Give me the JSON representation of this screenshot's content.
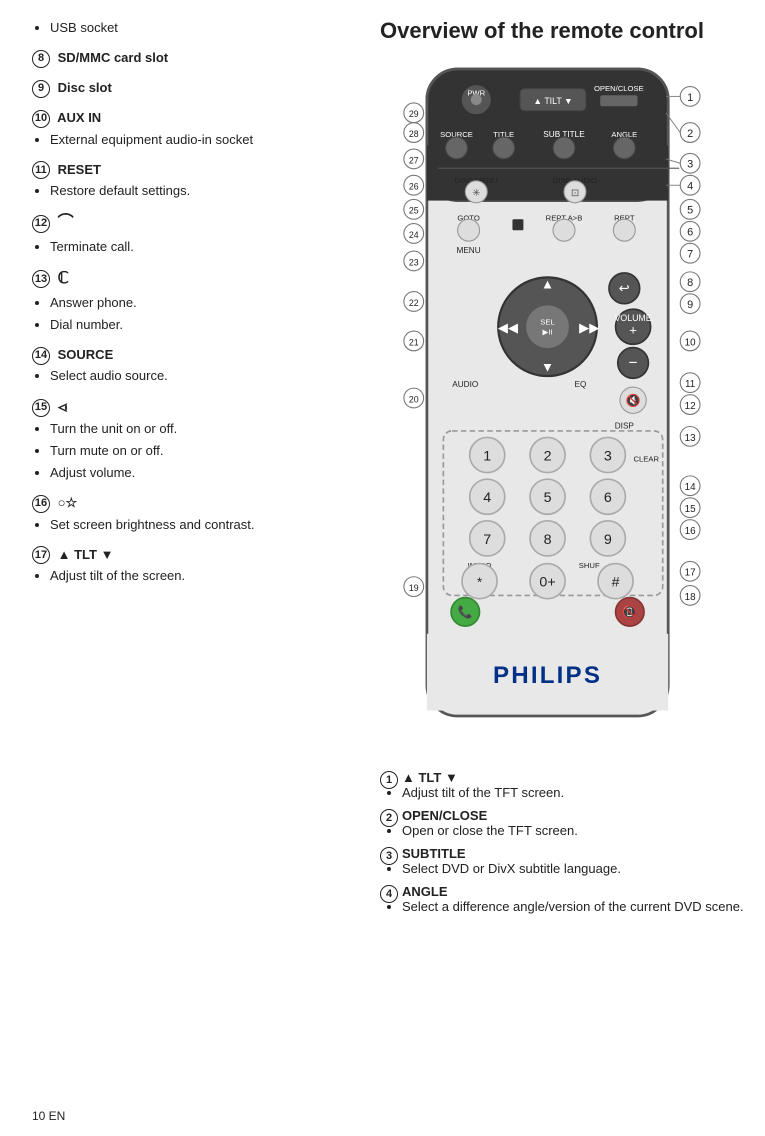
{
  "left": {
    "sections": [
      {
        "id": "usb",
        "bullet": "USB socket",
        "num": null
      },
      {
        "id": "sdmmc",
        "num": "8",
        "title": "SD/MMC card slot",
        "bullets": []
      },
      {
        "id": "discslot",
        "num": "9",
        "title": "Disc slot",
        "bullets": []
      },
      {
        "id": "auxin",
        "num": "10",
        "title": "AUX IN",
        "bullets": [
          "External equipment audio-in socket"
        ]
      },
      {
        "id": "reset",
        "num": "11",
        "title": "RESET",
        "bullets": [
          "Restore default settings."
        ]
      },
      {
        "id": "hangup",
        "num": "12",
        "title": "↩",
        "title_symbol": true,
        "bullets": [
          "Terminate call."
        ]
      },
      {
        "id": "answer",
        "num": "13",
        "title": "↪",
        "title_symbol": true,
        "bullets": [
          "Answer phone.",
          "Dial number."
        ]
      },
      {
        "id": "source",
        "num": "14",
        "title": "SOURCE",
        "bullets": [
          "Select audio source."
        ]
      },
      {
        "id": "power",
        "num": "15",
        "title": "⏻",
        "title_symbol": true,
        "bullets": [
          "Turn the unit on or off.",
          "Turn mute on or off.",
          "Adjust volume."
        ]
      },
      {
        "id": "brightness",
        "num": "16",
        "title": "○☆",
        "title_symbol": true,
        "bullets": [
          "Set screen brightness and contrast."
        ]
      },
      {
        "id": "tlt",
        "num": "17",
        "title": "▲ TLT ▼",
        "bullets": [
          "Adjust tilt of the screen."
        ]
      }
    ]
  },
  "right": {
    "overview_title": "Overview of the remote control",
    "bottom_items": [
      {
        "num": "1",
        "title": "▲ TLT ▼",
        "bullets": [
          "Adjust tilt of the TFT screen."
        ]
      },
      {
        "num": "2",
        "title": "OPEN/CLOSE",
        "bullets": [
          "Open or close the TFT screen."
        ]
      },
      {
        "num": "3",
        "title": "SUBTITLE",
        "bullets": [
          "Select DVD or DivX subtitle language."
        ]
      },
      {
        "num": "4",
        "title": "ANGLE",
        "bullets": [
          "Select a difference angle/version of the current DVD scene."
        ]
      }
    ]
  },
  "page": "10   EN"
}
